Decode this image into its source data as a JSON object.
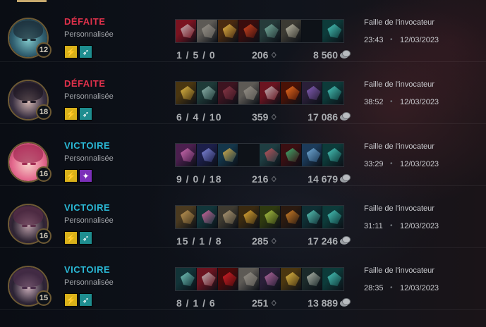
{
  "matches": [
    {
      "result": "DÉFAITE",
      "result_type": "defeat",
      "queue": "Personnalisée",
      "level": "12",
      "avatar_colors": [
        "#2f5d6e",
        "#7fc6c9",
        "#1b2a33"
      ],
      "spells": [
        {
          "icon": "flash-icon",
          "color": "#d9b11a",
          "glyph": "⚡"
        },
        {
          "icon": "ghost-icon",
          "color": "#1e8d8f",
          "glyph": "➶"
        }
      ],
      "items": [
        {
          "icon": "item-blade-icon",
          "colors": [
            "#7a1320",
            "#c9c2c4"
          ]
        },
        {
          "icon": "item-boots-icon",
          "colors": [
            "#5d5a55",
            "#9a958c"
          ]
        },
        {
          "icon": "item-lightning-icon",
          "colors": [
            "#4a2a10",
            "#f2c24a"
          ]
        },
        {
          "icon": "item-fire-blade-icon",
          "colors": [
            "#3a0d0d",
            "#e04c22"
          ]
        },
        {
          "icon": "item-dagger-icon",
          "colors": [
            "#263b3a",
            "#7fb9a8"
          ]
        },
        {
          "icon": "item-sword-icon",
          "colors": [
            "#3c3a33",
            "#c9c6b2"
          ]
        },
        {
          "icon": "empty-slot",
          "colors": [
            "#0e1218",
            "#0e1218"
          ]
        },
        {
          "icon": "ward-trinket-icon",
          "colors": [
            "#0d3b3a",
            "#4fd4c8"
          ]
        }
      ],
      "kda": "1 / 5 / 0",
      "cs": "206",
      "gold": "8 560",
      "map": "Faille de l'invocateur",
      "duration": "23:43",
      "date": "12/03/2023"
    },
    {
      "result": "DÉFAITE",
      "result_type": "defeat",
      "queue": "Personnalisée",
      "level": "18",
      "avatar_colors": [
        "#3a3143",
        "#d2b5b0",
        "#1c1620"
      ],
      "spells": [
        {
          "icon": "flash-icon",
          "color": "#d9b11a",
          "glyph": "⚡"
        },
        {
          "icon": "ghost-icon",
          "color": "#1e8d8f",
          "glyph": "➶"
        }
      ],
      "items": [
        {
          "icon": "item-lightning-blade-icon",
          "colors": [
            "#4a3610",
            "#f0c64a"
          ]
        },
        {
          "icon": "item-shield-icon",
          "colors": [
            "#1e3a38",
            "#9ac0b8"
          ]
        },
        {
          "icon": "item-axe-icon",
          "colors": [
            "#3d1420",
            "#8e3b4a"
          ]
        },
        {
          "icon": "item-boots-icon",
          "colors": [
            "#5d5a55",
            "#9a958c"
          ]
        },
        {
          "icon": "item-blade-icon",
          "colors": [
            "#6b1420",
            "#c9c2c4"
          ]
        },
        {
          "icon": "item-fire-sword-icon",
          "colors": [
            "#4a1206",
            "#ff7a22"
          ]
        },
        {
          "icon": "item-orb-icon",
          "colors": [
            "#2a1f38",
            "#8c64c4"
          ]
        },
        {
          "icon": "ward-trinket-icon",
          "colors": [
            "#0d3b3a",
            "#4fd4c8"
          ]
        }
      ],
      "kda": "6 / 4 / 10",
      "cs": "359",
      "gold": "17 086",
      "map": "Faille de l'invocateur",
      "duration": "38:52",
      "date": "12/03/2023"
    },
    {
      "result": "VICTOIRE",
      "result_type": "victory",
      "queue": "Personnalisée",
      "level": "16",
      "avatar_colors": [
        "#e46a8e",
        "#f7d2c9",
        "#a12a52"
      ],
      "spells": [
        {
          "icon": "flash-icon",
          "color": "#d9b11a",
          "glyph": "⚡"
        },
        {
          "icon": "ignite-icon",
          "color": "#7b2fb8",
          "glyph": "✦"
        }
      ],
      "items": [
        {
          "icon": "item-book-icon",
          "colors": [
            "#4b1f4e",
            "#d874b8"
          ]
        },
        {
          "icon": "item-staff-icon",
          "colors": [
            "#1c1f4a",
            "#8a92e8"
          ]
        },
        {
          "icon": "item-scepter-icon",
          "colors": [
            "#14364a",
            "#e6b84a"
          ]
        },
        {
          "icon": "empty-slot",
          "colors": [
            "#0e1218",
            "#0e1218"
          ]
        },
        {
          "icon": "item-mask-icon",
          "colors": [
            "#1f3e42",
            "#d0535c"
          ]
        },
        {
          "icon": "item-horn-icon",
          "colors": [
            "#3b0f12",
            "#3fbf7a"
          ]
        },
        {
          "icon": "item-boots-icon",
          "colors": [
            "#1c3b5a",
            "#7ab4e0"
          ]
        },
        {
          "icon": "ward-trinket-icon",
          "colors": [
            "#0d3b3a",
            "#4fd4c8"
          ]
        }
      ],
      "kda": "9 / 0 / 18",
      "cs": "216",
      "gold": "14 679",
      "map": "Faille de l'invocateur",
      "duration": "33:29",
      "date": "12/03/2023"
    },
    {
      "result": "VICTOIRE",
      "result_type": "victory",
      "queue": "Personnalisée",
      "level": "16",
      "avatar_colors": [
        "#2d2433",
        "#b99ca6",
        "#5a2e48"
      ],
      "spells": [
        {
          "icon": "flash-icon",
          "color": "#d9b11a",
          "glyph": "⚡"
        },
        {
          "icon": "ghost-icon",
          "color": "#1e8d8f",
          "glyph": "➶"
        }
      ],
      "items": [
        {
          "icon": "item-clock-icon",
          "colors": [
            "#4a3a20",
            "#c9a05a"
          ]
        },
        {
          "icon": "item-crystal-blade-icon",
          "colors": [
            "#12363a",
            "#e46aa8"
          ]
        },
        {
          "icon": "item-boots-icon",
          "colors": [
            "#3e3a30",
            "#b9a27a"
          ]
        },
        {
          "icon": "item-lightning-icon",
          "colors": [
            "#3a2a10",
            "#f2b83a"
          ]
        },
        {
          "icon": "item-wand-icon",
          "colors": [
            "#2f3a10",
            "#b6d04a"
          ]
        },
        {
          "icon": "item-gauntlet-icon",
          "colors": [
            "#2b1a10",
            "#e08a2a"
          ]
        },
        {
          "icon": "item-trident-icon",
          "colors": [
            "#0f2f34",
            "#5fd4c4"
          ]
        },
        {
          "icon": "ward-trinket-icon",
          "colors": [
            "#0d3b3a",
            "#4fd4c8"
          ]
        }
      ],
      "kda": "15 / 1 / 8",
      "cs": "285",
      "gold": "17 246",
      "map": "Faille de l'invocateur",
      "duration": "31:11",
      "date": "12/03/2023"
    },
    {
      "result": "VICTOIRE",
      "result_type": "victory",
      "queue": "Personnalisée",
      "level": "15",
      "avatar_colors": [
        "#2b2334",
        "#c4a8b4",
        "#4a2d4a"
      ],
      "spells": [
        {
          "icon": "flash-icon",
          "color": "#d9b11a",
          "glyph": "⚡"
        },
        {
          "icon": "ghost-icon",
          "color": "#1e8d8f",
          "glyph": "➶"
        }
      ],
      "items": [
        {
          "icon": "item-claw-icon",
          "colors": [
            "#123438",
            "#7fd4c8"
          ]
        },
        {
          "icon": "item-blade-icon",
          "colors": [
            "#6b1420",
            "#c9c2c4"
          ]
        },
        {
          "icon": "item-eye-icon",
          "colors": [
            "#4a0a0a",
            "#e0222a"
          ]
        },
        {
          "icon": "item-boots-icon",
          "colors": [
            "#5d5a55",
            "#9a958c"
          ]
        },
        {
          "icon": "item-dagger-icon",
          "colors": [
            "#2a1f38",
            "#c070a8"
          ]
        },
        {
          "icon": "item-lightning-blade-icon",
          "colors": [
            "#4a3610",
            "#f0c64a"
          ]
        },
        {
          "icon": "item-horn-icon",
          "colors": [
            "#1b2a2a",
            "#c0c4b8"
          ]
        },
        {
          "icon": "ward-trinket-icon",
          "colors": [
            "#0d3b3a",
            "#4fd4c8"
          ]
        }
      ],
      "kda": "8 / 1 / 6",
      "cs": "251",
      "gold": "13 889",
      "map": "Faille de l'invocateur",
      "duration": "28:35",
      "date": "12/03/2023"
    }
  ],
  "icons": {
    "cs": "minion-icon",
    "gold": "gold-coins-icon"
  }
}
